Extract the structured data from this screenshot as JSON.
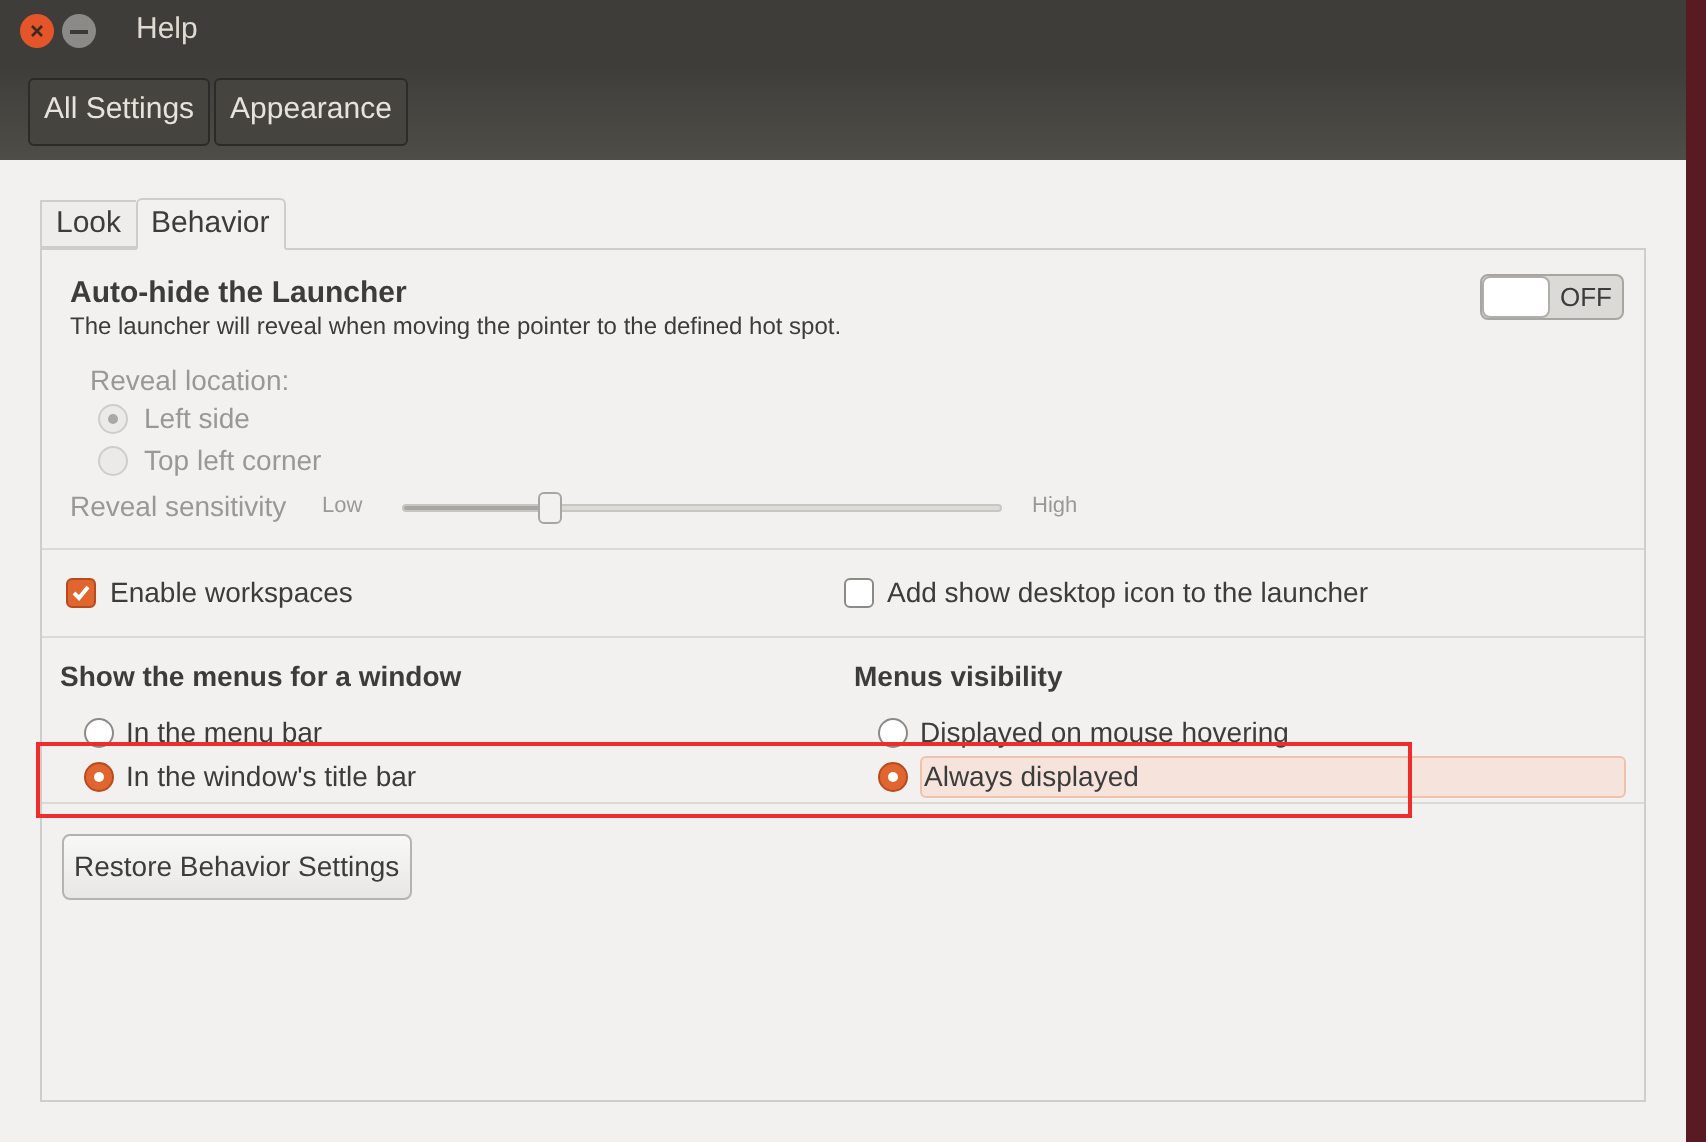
{
  "window": {
    "title": "Help"
  },
  "toolbar": {
    "buttons": [
      "All Settings",
      "Appearance"
    ]
  },
  "tabs": [
    {
      "label": "Look",
      "selected": false
    },
    {
      "label": "Behavior",
      "selected": true
    }
  ],
  "autohide": {
    "title": "Auto-hide the Launcher",
    "description": "The launcher will reveal when moving the pointer to the defined hot spot.",
    "switch_label": "OFF",
    "on": false,
    "reveal_location": {
      "label": "Reveal location:",
      "options": [
        {
          "label": "Left side",
          "selected": true
        },
        {
          "label": "Top left corner",
          "selected": false
        }
      ]
    },
    "sensitivity": {
      "label": "Reveal sensitivity",
      "low": "Low",
      "high": "High",
      "level": 0.245
    }
  },
  "checkboxes": [
    {
      "label": "Enable workspaces",
      "checked": true
    },
    {
      "label": "Add show desktop icon to the launcher",
      "checked": false
    }
  ],
  "menus_group": {
    "title": "Show the menus for a window",
    "options": [
      {
        "label": "In the menu bar",
        "selected": false
      },
      {
        "label": "In the window's title bar",
        "selected": true
      }
    ]
  },
  "visibility_group": {
    "title": "Menus visibility",
    "options": [
      {
        "label": "Displayed on mouse hovering",
        "selected": false
      },
      {
        "label": "Always displayed",
        "selected": true
      }
    ]
  },
  "restore_button": "Restore Behavior Settings"
}
